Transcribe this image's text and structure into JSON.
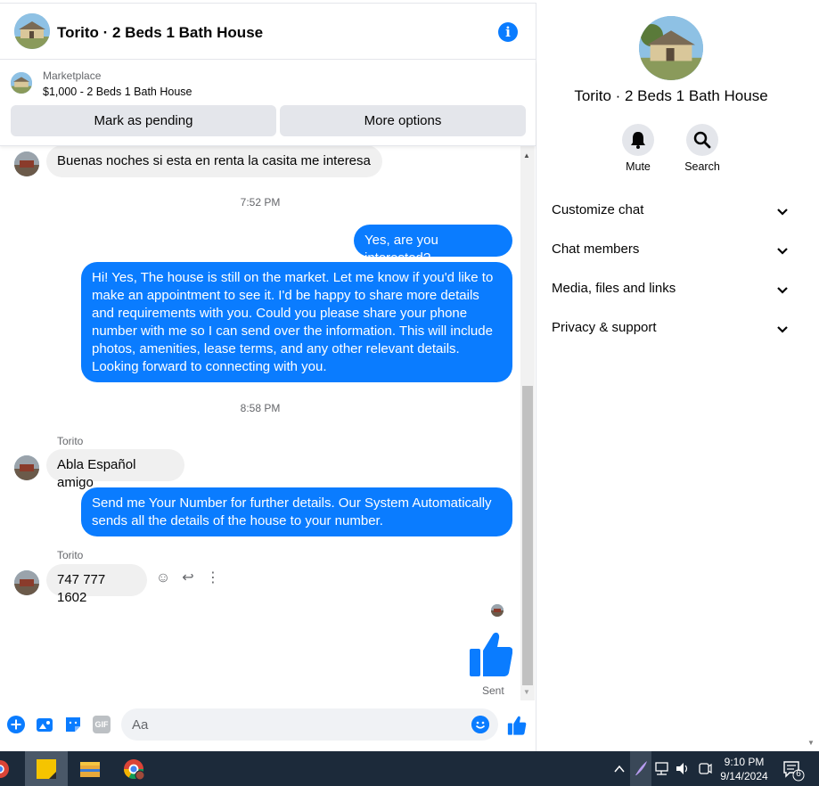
{
  "chat": {
    "title": "Torito · 2 Beds 1 Bath House",
    "marketplace_label": "Marketplace",
    "listing_price": "$1,000 - 2 Beds 1 Bath House",
    "mark_pending_label": "Mark as pending",
    "more_options_label": "More options"
  },
  "messages": {
    "m1": "Buenas  noches  si esta en renta la casita  me interesa",
    "t1": "7:52 PM",
    "m2": "Yes, are you interested?",
    "m3": "Hi! Yes, The house is still on the market. Let me know if you'd like to make an appointment to see it. I'd be happy to share more details and requirements with you. Could you please share your phone number with me so I can send over the information. This will include photos, amenities, lease terms, and any other relevant details. Looking forward to connecting with you.",
    "t2": "8:58 PM",
    "sender1": "Torito",
    "m4": "Abla Español amigo",
    "m5": "Send me Your Number for further details. Our System Automatically sends all the details of the house to your  number.",
    "sender2": "Torito",
    "m6": "747 777 1602",
    "sent_label": "Sent"
  },
  "composer": {
    "placeholder": "Aa",
    "gif_label": "GIF"
  },
  "info": {
    "name": "Torito · 2 Beds 1 Bath House",
    "mute_label": "Mute",
    "search_label": "Search",
    "sections": [
      "Customize chat",
      "Chat members",
      "Media, files and links",
      "Privacy & support"
    ]
  },
  "taskbar": {
    "time": "9:10 PM",
    "date": "9/14/2024",
    "notification_count": "6"
  },
  "colors": {
    "accent": "#0a7cff",
    "incoming_bubble": "#f0f0f0",
    "taskbar": "#1c2a3a"
  }
}
